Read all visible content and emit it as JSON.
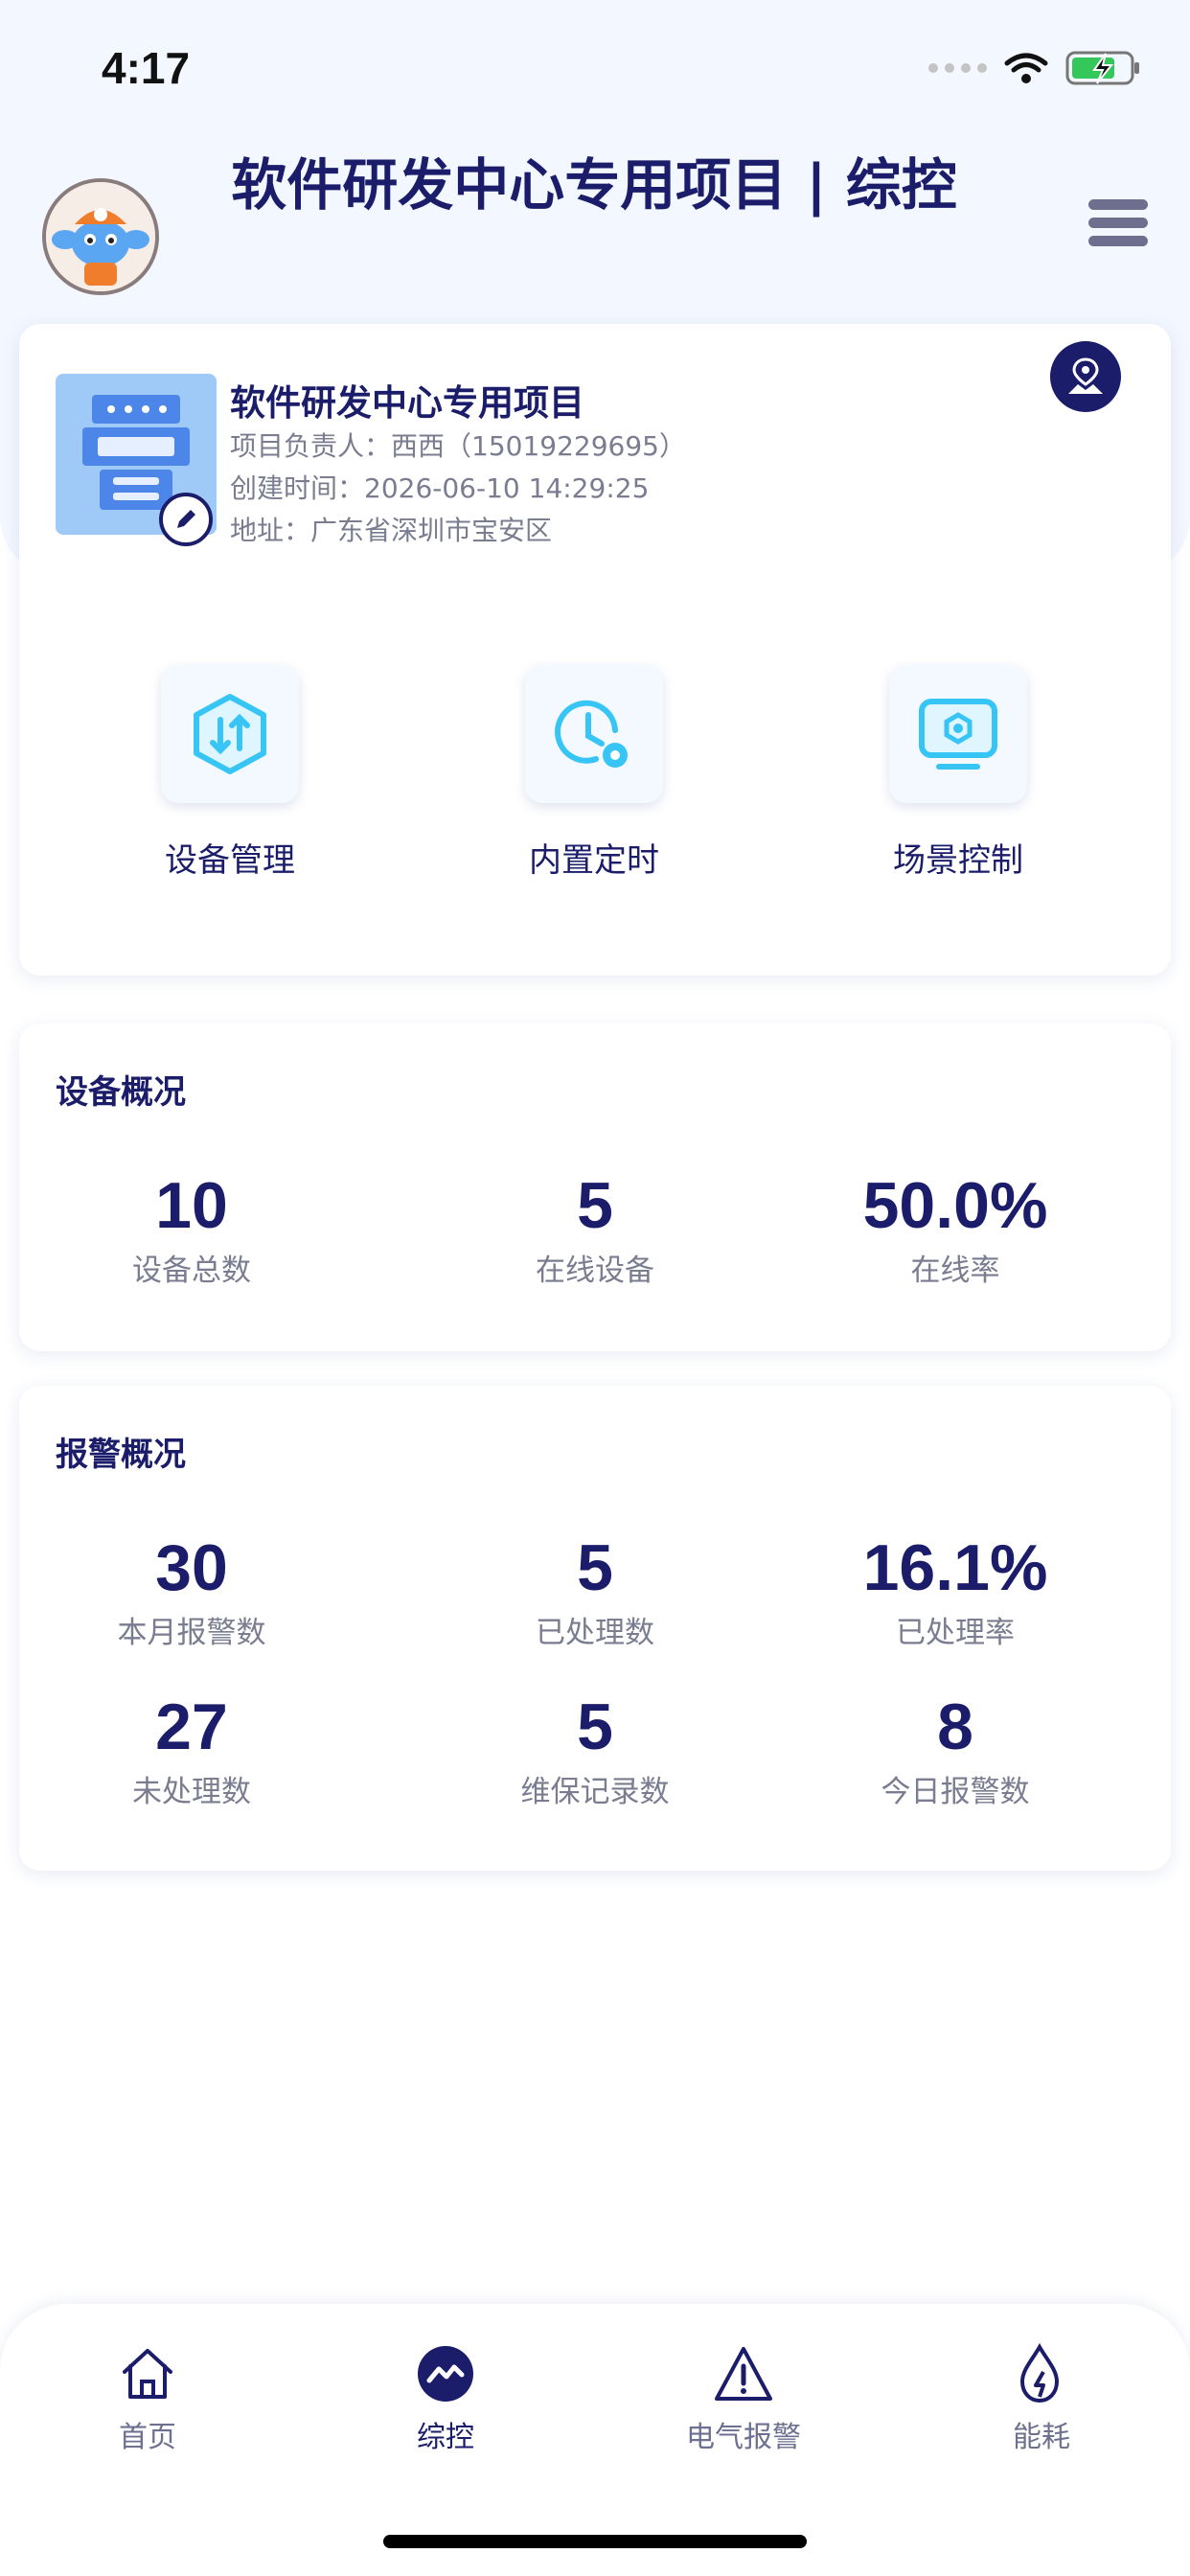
{
  "status_bar": {
    "time": "4:17"
  },
  "header": {
    "title": "软件研发中心专用项目 | 综控"
  },
  "project": {
    "name": "软件研发中心专用项目",
    "manager": "项目负责人：西西（15019229695）",
    "created": "创建时间：2026-06-10 14:29:25",
    "address": "地址：广东省深圳市宝安区"
  },
  "quick_actions": [
    {
      "label": "设备管理",
      "icon": "device-manage-icon"
    },
    {
      "label": "内置定时",
      "icon": "clock-gear-icon"
    },
    {
      "label": "场景控制",
      "icon": "scene-monitor-icon"
    }
  ],
  "device_overview": {
    "title": "设备概况",
    "stats": [
      {
        "value": "10",
        "label": "设备总数"
      },
      {
        "value": "5",
        "label": "在线设备"
      },
      {
        "value": "50.0%",
        "label": "在线率"
      }
    ]
  },
  "alarm_overview": {
    "title": "报警概况",
    "stats": [
      {
        "value": "30",
        "label": "本月报警数"
      },
      {
        "value": "5",
        "label": "已处理数"
      },
      {
        "value": "16.1%",
        "label": "已处理率"
      },
      {
        "value": "27",
        "label": "未处理数"
      },
      {
        "value": "5",
        "label": "维保记录数"
      },
      {
        "value": "8",
        "label": "今日报警数"
      }
    ]
  },
  "tabs": [
    {
      "label": "首页",
      "icon": "home-icon",
      "active": false
    },
    {
      "label": "综控",
      "icon": "control-icon",
      "active": true
    },
    {
      "label": "电气报警",
      "icon": "warning-icon",
      "active": false
    },
    {
      "label": "能耗",
      "icon": "energy-drop-icon",
      "active": false
    }
  ],
  "colors": {
    "primary": "#1b1d6b",
    "accent": "#36c5f4",
    "muted": "#7a7c90",
    "background": "#f3f7ff"
  }
}
